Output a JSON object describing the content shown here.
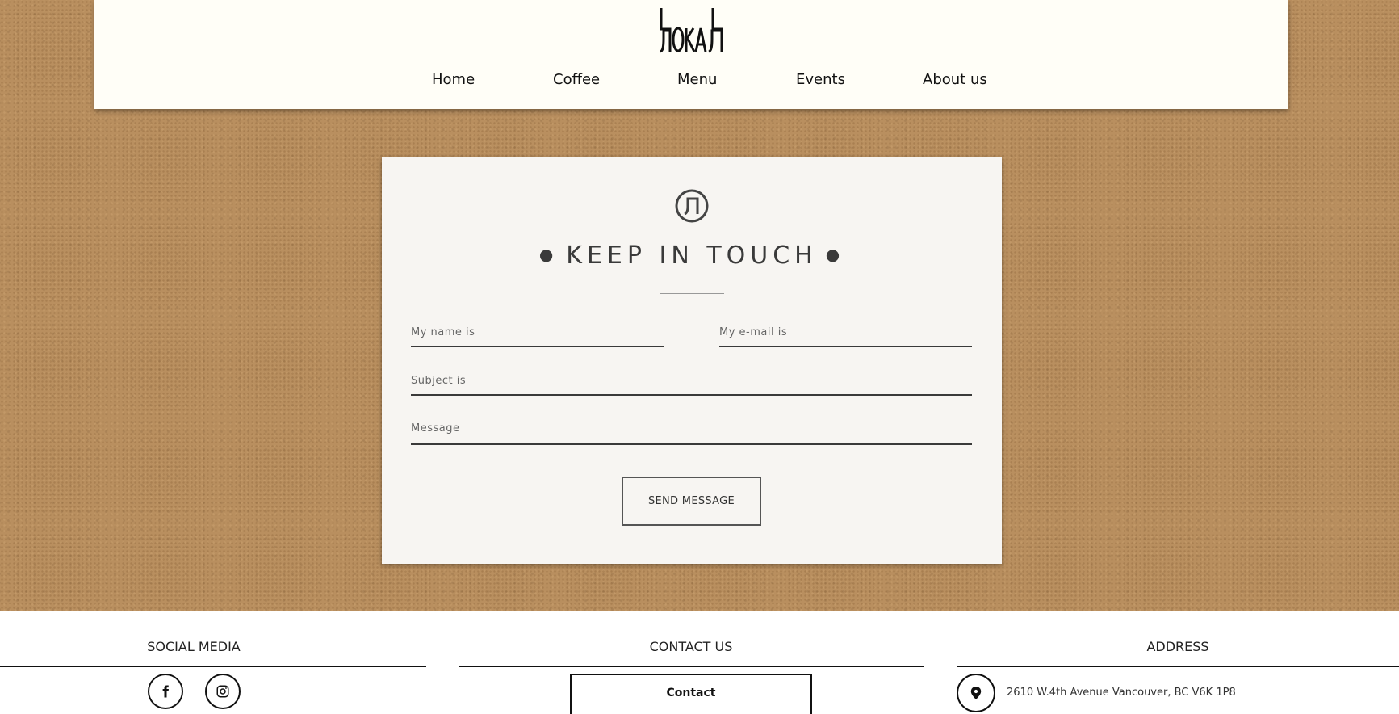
{
  "header": {
    "logo_text": "ЊOKAЊ",
    "nav": [
      {
        "label": "Home"
      },
      {
        "label": "Coffee"
      },
      {
        "label": "Menu"
      },
      {
        "label": "Events"
      },
      {
        "label": "About us"
      }
    ]
  },
  "contact_form": {
    "title": "KEEP IN TOUCH",
    "name_placeholder": "My name is",
    "email_placeholder": "My e-mail is",
    "subject_placeholder": "Subject is",
    "message_placeholder": "Message",
    "send_label": "SEND MESSAGE"
  },
  "footer": {
    "social_heading": "SOCIAL MEDIA",
    "contact_heading": "CONTACT US",
    "address_heading": "ADDRESS",
    "contact_button": "Contact",
    "address": "2610 W.4th Avenue Vancouver, BC V6K 1P8",
    "social_icons": [
      "facebook-icon",
      "instagram-icon"
    ]
  },
  "colors": {
    "background": "#b98f5f",
    "header_bg": "#fffef7",
    "card_bg": "#f7f5f2",
    "text_dark": "#3a3a3a"
  }
}
